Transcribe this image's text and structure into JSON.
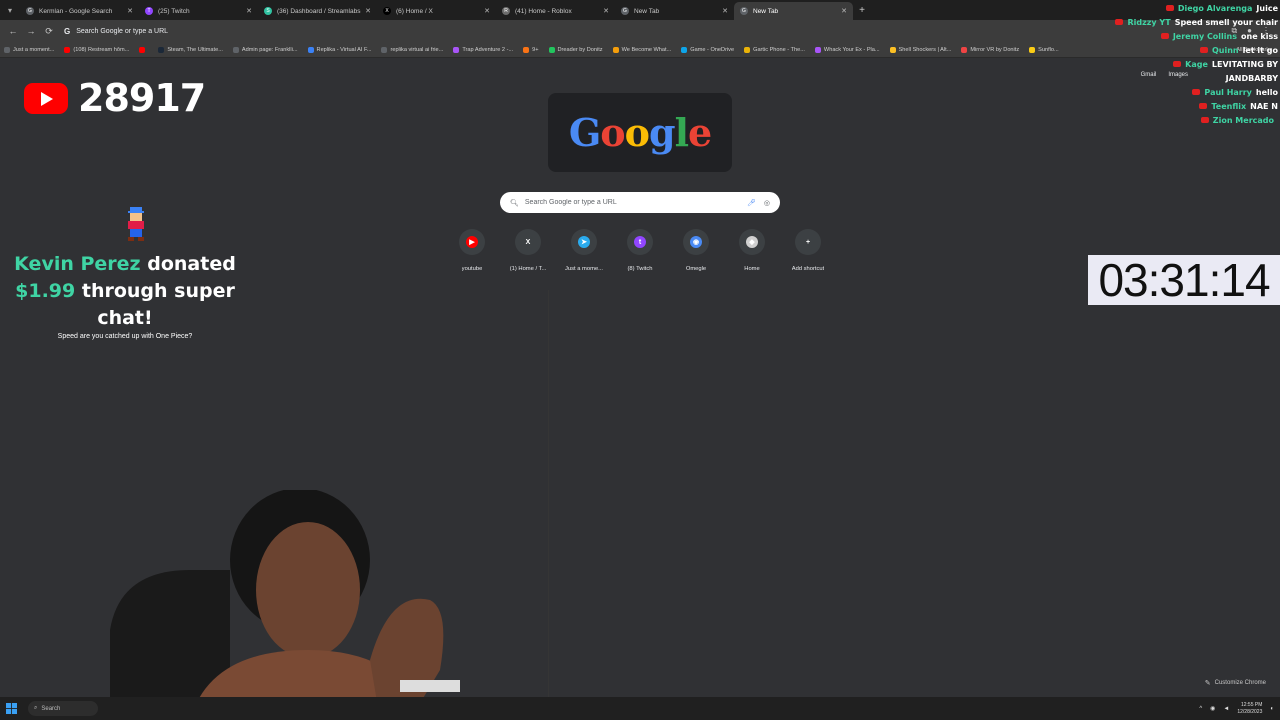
{
  "browser": {
    "tabs": [
      {
        "title": "Kermlan - Google Search",
        "color": "#5f6368",
        "glyph": "G",
        "active": false
      },
      {
        "title": "(25) Twitch",
        "color": "#9146ff",
        "glyph": "T",
        "active": false
      },
      {
        "title": "(36) Dashboard / Streamlabs",
        "color": "#31c3a2",
        "glyph": "S",
        "active": false
      },
      {
        "title": "(6) Home / X",
        "color": "#000000",
        "glyph": "X",
        "active": false
      },
      {
        "title": "(41) Home - Roblox",
        "color": "#6d6d6d",
        "glyph": "R",
        "active": false
      },
      {
        "title": "New Tab",
        "color": "#5f6368",
        "glyph": "G",
        "active": false
      },
      {
        "title": "New Tab",
        "color": "#5f6368",
        "glyph": "G",
        "active": true
      }
    ],
    "omnibox_placeholder": "Search Google or type a URL",
    "bookmarks": [
      {
        "label": "Just a moment...",
        "color": "#5f6368"
      },
      {
        "label": "(108) Restream hôm...",
        "color": "#ff0000"
      },
      {
        "label": "",
        "color": "#ff0000"
      },
      {
        "label": "Steam, The Ultimate...",
        "color": "#1b2838"
      },
      {
        "label": "Admin page: Franklli...",
        "color": "#5f6368"
      },
      {
        "label": "Replika - Virtual AI F...",
        "color": "#3b82f6"
      },
      {
        "label": "replika virtual ai frie...",
        "color": "#5f6368"
      },
      {
        "label": "Trap Adventure 2 -...",
        "color": "#a855f7"
      },
      {
        "label": "9+",
        "color": "#f97316"
      },
      {
        "label": "Dreader by Donitz",
        "color": "#22c55e"
      },
      {
        "label": "We Become What...",
        "color": "#f59e0b"
      },
      {
        "label": "Game - OneDrive",
        "color": "#0ea5e9"
      },
      {
        "label": "Gartic Phone - The...",
        "color": "#eab308"
      },
      {
        "label": "Whack Your Ex - Pla...",
        "color": "#a855f7"
      },
      {
        "label": "Shell Shockers | Alt...",
        "color": "#fbbf24"
      },
      {
        "label": "Mirror VR by Donitz",
        "color": "#ef4444"
      },
      {
        "label": "Sunflo...",
        "color": "#facc15"
      }
    ],
    "all_bookmarks": "All Bookmarks"
  },
  "ntp": {
    "links": [
      "Gmail",
      "Images"
    ],
    "doodle_letters": [
      "G",
      "o",
      "o",
      "g",
      "l",
      "e"
    ],
    "search_placeholder": "Search Google or type a URL",
    "shortcuts": [
      {
        "label": "youtube",
        "color": "#ff0000",
        "glyph": "▶"
      },
      {
        "label": "(1) Home / T...",
        "color": "#3c4043",
        "glyph": "X"
      },
      {
        "label": "Just a mome...",
        "color": "#2aabee",
        "glyph": "➤"
      },
      {
        "label": "(8) Twitch",
        "color": "#9146ff",
        "glyph": "t"
      },
      {
        "label": "Omegle",
        "color": "#4a8af4",
        "glyph": "◉"
      },
      {
        "label": "Home",
        "color": "#d0d0d0",
        "glyph": "◆"
      },
      {
        "label": "Add shortcut",
        "color": "transparent",
        "glyph": "+"
      }
    ],
    "customize": "Customize Chrome"
  },
  "overlay": {
    "youtube_count": "28917",
    "donation_name": "Kevin Perez",
    "donation_verb": "donated",
    "donation_amount": "$1.99",
    "donation_rest": "through super chat!",
    "donation_message": "Speed are you catched up with One Piece?",
    "timer": "03:31:14"
  },
  "chat": [
    {
      "user": "Diego Alvarenga",
      "msg": "Juice",
      "color": "#3fd4a4"
    },
    {
      "user": "Ridzzy YT",
      "msg": "Speed smell your chair",
      "color": "#3fd4a4"
    },
    {
      "user": "Jeremy Collins",
      "msg": "one kiss",
      "color": "#3fd4a4"
    },
    {
      "user": "Quinn",
      "msg": "let it go",
      "color": "#3fd4a4"
    },
    {
      "user": "Kage",
      "msg": "LEVITATING BY",
      "color": "#3fd4a4"
    },
    {
      "user": "",
      "msg": "JANDBARBY",
      "color": "#3fd4a4"
    },
    {
      "user": "Paul Harry",
      "msg": "hello",
      "color": "#3fd4a4"
    },
    {
      "user": "Teenflix",
      "msg": "NAE N",
      "color": "#3fd4a4"
    },
    {
      "user": "Zion Mercado",
      "msg": "",
      "color": "#3fd4a4"
    }
  ],
  "taskbar": {
    "search_placeholder": "Search",
    "time": "12:55 PM",
    "date": "12/28/2023"
  }
}
